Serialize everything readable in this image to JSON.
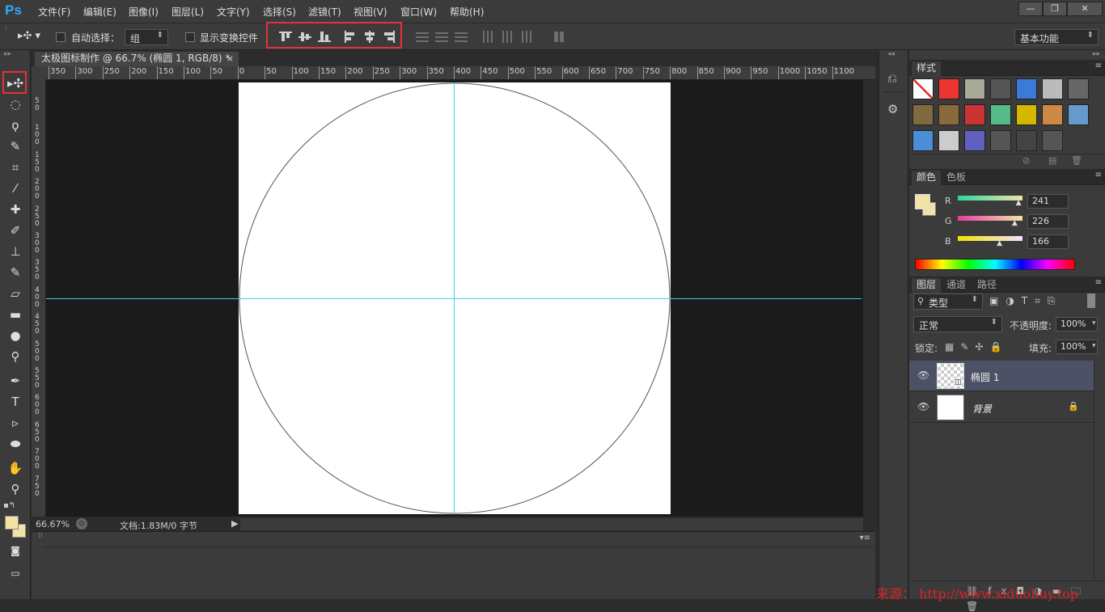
{
  "app": {
    "logo": "Ps"
  },
  "menu": [
    "文件(F)",
    "编辑(E)",
    "图像(I)",
    "图层(L)",
    "文字(Y)",
    "选择(S)",
    "滤镜(T)",
    "视图(V)",
    "窗口(W)",
    "帮助(H)"
  ],
  "window_controls": {
    "minimize": "—",
    "restore": "❐",
    "close": "✕"
  },
  "options": {
    "auto_select_label": "自动选择：",
    "auto_select_value": "组",
    "show_transform_label": "显示变换控件",
    "workspace": "基本功能"
  },
  "document": {
    "tab_title": "太极图标制作 @ 66.7% (椭圆 1, RGB/8) *",
    "close": "×",
    "zoom": "66.67%",
    "doc_info": "文档:1.83M/0 字节",
    "hruler_ticks": [
      "350",
      "300",
      "250",
      "200",
      "150",
      "100",
      "50",
      "0",
      "50",
      "100",
      "150",
      "200",
      "250",
      "300",
      "350",
      "400",
      "450",
      "500",
      "550",
      "600",
      "650",
      "700",
      "750",
      "800",
      "850",
      "900",
      "950",
      "1000",
      "1050",
      "1100"
    ],
    "vruler_ticks": [
      "5 0",
      "1 0 0",
      "1 5 0",
      "2 0 0",
      "2 5 0",
      "3 0 0",
      "3 5 0",
      "4 0 0",
      "4 5 0",
      "5 0 0",
      "5 5 0",
      "6 0 0",
      "6 5 0",
      "7 0 0",
      "7 5 0"
    ]
  },
  "styles_panel": {
    "tab": "样式"
  },
  "color_panel": {
    "tabs": [
      "颜色",
      "色板"
    ],
    "channels": [
      {
        "label": "R",
        "value": "241",
        "level": 0.945
      },
      {
        "label": "G",
        "value": "226",
        "level": 0.886
      },
      {
        "label": "B",
        "value": "166",
        "level": 0.651
      }
    ],
    "fg_color": "#f1e2a6"
  },
  "layers_panel": {
    "tabs": [
      "图层",
      "通道",
      "路径"
    ],
    "filter": "类型",
    "blend_mode": "正常",
    "opacity_label": "不透明度:",
    "opacity": "100%",
    "lock_label": "锁定:",
    "fill_label": "填充:",
    "fill": "100%",
    "layers": [
      {
        "name": "椭圆 1",
        "selected": true
      },
      {
        "name": "背景",
        "selected": false
      }
    ]
  },
  "watermark": "来源： http://www.xiduobuy.top"
}
